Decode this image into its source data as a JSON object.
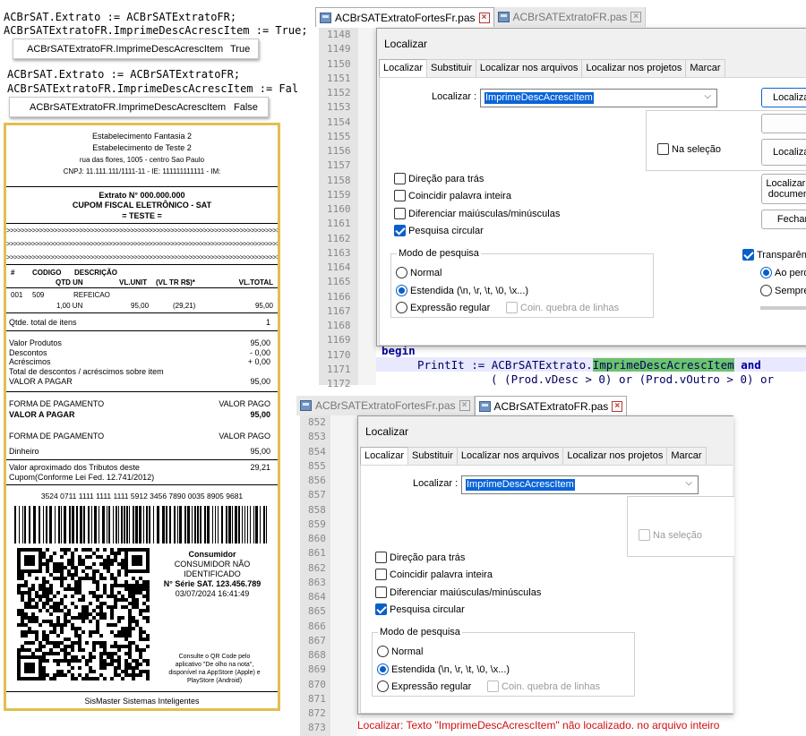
{
  "code_snippets": {
    "top_line1": "ACBrSAT.Extrato := ACBrSATExtratoFR;",
    "top_line2": "ACBrSATExtratoFR.ImprimeDescAcrescItem := True;",
    "top_inspect_name": "ACBrSATExtratoFR.ImprimeDescAcrescItem",
    "top_inspect_value": "True",
    "mid_line1": "ACBrSAT.Extrato := ACBrSATExtratoFR;",
    "mid_line2": "ACBrSATExtratoFR.ImprimeDescAcrescItem := Fal",
    "mid_inspect_name": "ACBrSATExtratoFR.ImprimeDescAcrescItem",
    "mid_inspect_value": "False"
  },
  "receipt": {
    "header": [
      "Estabelecimento Fantasia 2",
      "Estabelecimento de Teste 2",
      "rua das flores, 1005 - centro Sao Paulo",
      "CNPJ: 11.111.111/1111-11 - IE: 111111111111 - IM:"
    ],
    "extrato": "Extrato N° 000.000.000",
    "cupom": "CUPOM FISCAL ELETRÔNICO - SAT",
    "teste": "=    TESTE    =",
    "gt_line": ">>>>>>>>>>>>>>>>>>>>>>>>>>>>>>>>>>>>>>>>>>>>>>>>>>>>>>>>>>>>>>>>>>>>>>>>>>>>",
    "col_hash": "#",
    "col_codigo": "CODIGO",
    "col_descricao": "DESCRIÇÃO",
    "col_qtd": "QTD UN",
    "col_vlunit": "VL.UNIT",
    "col_vltr": "(VL TR R$)*",
    "col_vltotal": "VL.TOTAL",
    "item_num": "001",
    "item_code": "509",
    "item_desc": "REFEICAO",
    "item_qtd": "1,00 UN",
    "item_unit": "95,00",
    "item_tr": "(29,21)",
    "item_total": "95,00",
    "qtde_label": "Qtde. total de itens",
    "qtde_value": "1",
    "valor_produtos_label": "Valor Produtos",
    "valor_produtos": "95,00",
    "descontos_label": "Descontos",
    "descontos": "- 0,00",
    "acrescimos_label": "Acréscimos",
    "acrescimos": "+ 0,00",
    "total_desc_label": "Total de descontos / acréscimos sobre item",
    "valor_pagar_label": "VALOR A PAGAR",
    "valor_pagar": "95,00",
    "forma_pag_label": "FORMA DE PAGAMENTO",
    "valor_pago_label": "VALOR PAGO",
    "valor_pagar_label2": "VALOR A PAGAR",
    "valor_pagar2": "95,00",
    "forma_pag_label2": "FORMA DE PAGAMENTO",
    "valor_pago_label2": "VALOR PAGO",
    "dinheiro_label": "Dinheiro",
    "dinheiro": "95,00",
    "tributos_label1": "Valor aproximado dos Tributos deste",
    "tributos_label2": "Cupom(Conforme Lei Fed. 12.741/2012)",
    "tributos_value": "29,21",
    "chave": "3524 0711 1111 1111 1111 5912 3456 7890 0035 8905 9681",
    "consumidor_title": "Consumidor",
    "consumidor_line1": "CONSUMIDOR NÃO",
    "consumidor_line2": "IDENTIFICADO",
    "serie": "N° Série SAT. 123.456.789",
    "datetime": "03/07/2024 16:41:49",
    "consulte": [
      "Consulte o QR Code pelo",
      "aplicativo \"De olho na nota\",",
      "disponível na AppStore (Apple) e",
      "PlayStore (Android)"
    ],
    "footer": "SisMaster Sistemas Inteligentes"
  },
  "editor_top": {
    "tabs": [
      {
        "label": "ACBrSATExtratoFortesFr.pas",
        "active": true
      },
      {
        "label": "ACBrSATExtratoFR.pas",
        "active": false
      }
    ],
    "line_numbers": [
      "1148",
      "1149",
      "1150",
      "1151",
      "1152",
      "1153",
      "1154",
      "1155",
      "1156",
      "1157",
      "1158",
      "1159",
      "1160",
      "1161",
      "1162",
      "1163",
      "1164",
      "1165",
      "1166",
      "1167",
      "1168",
      "1169",
      "1170",
      "1171",
      "1172"
    ],
    "code_begin": "begin",
    "code_print_prefix": "PrintIt := ACBrSATExtrato.",
    "code_print_highlight": "ImprimeDescAcrescItem",
    "code_print_and": " and",
    "code_next": "( (Prod.vDesc > 0) or (Prod.vOutro > 0) or"
  },
  "dialog_top": {
    "title": "Localizar",
    "tabs": [
      "Localizar",
      "Substituir",
      "Localizar nos arquivos",
      "Localizar nos projetos",
      "Marcar"
    ],
    "search_label": "Localizar :",
    "search_value": "ImprimeDescAcrescItem",
    "na_selecao": "Na seleção",
    "direcao": "Direção para trás",
    "coincidir": "Coincidir palavra inteira",
    "diferenciar": "Diferenciar maiúsculas/minúsculas",
    "pesquisa": "Pesquisa circular",
    "modo": "Modo de pesquisa",
    "normal": "Normal",
    "estendida": "Estendida  (\\n, \\r, \\t, \\0, \\x...)",
    "expressao": "Expressão regular",
    "coin": "Coin. quebra de linhas",
    "transparencia": "Transparência",
    "ao_perder": "Ao perder",
    "sempre": "Sempre",
    "btn_localizar": "Localizar próximo",
    "btn_localizar_sel": "Localizar",
    "btn_localizar_doc": "Localizar no documento",
    "btn_fechar": "Fechar"
  },
  "editor_bottom": {
    "tabs": [
      {
        "label": "ACBrSATExtratoFortesFr.pas",
        "active": false
      },
      {
        "label": "ACBrSATExtratoFR.pas",
        "active": true
      }
    ],
    "line_numbers": [
      "852",
      "853",
      "854",
      "855",
      "856",
      "857",
      "858",
      "859",
      "860",
      "861",
      "862",
      "863",
      "864",
      "865",
      "866",
      "867",
      "868",
      "869",
      "870",
      "871",
      "872",
      "873"
    ]
  },
  "dialog_bottom": {
    "title": "Localizar",
    "tabs": [
      "Localizar",
      "Substituir",
      "Localizar nos arquivos",
      "Localizar nos projetos",
      "Marcar"
    ],
    "search_label": "Localizar :",
    "search_value": "ImprimeDescAcrescItem",
    "na_selecao": "Na seleção",
    "direcao": "Direção para trás",
    "coincidir": "Coincidir palavra inteira",
    "diferenciar": "Diferenciar maiúsculas/minúsculas",
    "pesquisa": "Pesquisa circular",
    "modo": "Modo de pesquisa",
    "normal": "Normal",
    "estendida": "Estendida  (\\n, \\r, \\t, \\0, \\x...)",
    "expressao": "Expressão regular",
    "coin": "Coin. quebra de linhas",
    "status": "Localizar: Texto \"ImprimeDescAcrescItem\" não localizado. no arquivo inteiro"
  },
  "colors": {
    "receipt_border": "#e2be4f",
    "highlight": "#0a64d8",
    "status_error": "#d01010",
    "search_match": "#6cc36c"
  }
}
